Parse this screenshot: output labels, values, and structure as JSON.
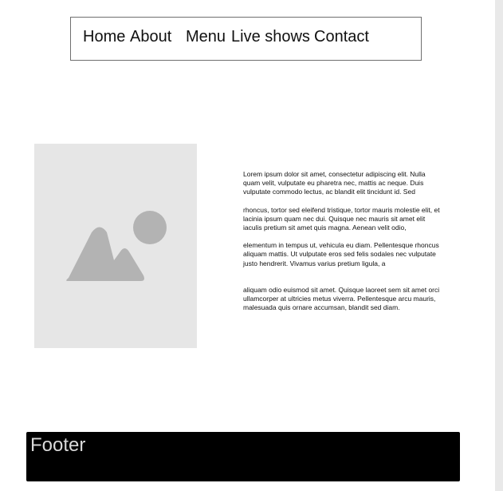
{
  "nav": {
    "items": [
      {
        "label": "Home"
      },
      {
        "label": "About"
      },
      {
        "label": "Menu"
      },
      {
        "label": "Live shows"
      },
      {
        "label": "Contact"
      }
    ]
  },
  "hero_image": {
    "icon": "image-placeholder-icon",
    "colors": {
      "background": "#e6e6e6",
      "shape": "#b3b3b3"
    }
  },
  "article": {
    "paragraphs": [
      "Lorem ipsum dolor sit amet, consectetur adipiscing elit. Nulla quam velit, vulputate eu pharetra nec, mattis ac neque. Duis vulputate commodo lectus, ac blandit elit tincidunt id. Sed",
      "rhoncus, tortor sed eleifend tristique, tortor mauris molestie elit, et lacinia ipsum quam nec dui. Quisque nec mauris sit amet elit iaculis pretium sit amet quis magna. Aenean velit odio,",
      "elementum in tempus ut, vehicula eu diam. Pellentesque rhoncus aliquam mattis. Ut vulputate eros sed felis sodales nec vulputate justo hendrerit. Vivamus varius pretium ligula, a",
      "aliquam odio euismod sit amet. Quisque laoreet sem sit amet orci ullamcorper at ultricies metus viverra. Pellentesque arcu mauris, malesuada quis ornare accumsan, blandit sed diam."
    ]
  },
  "footer": {
    "title": "Footer",
    "colors": {
      "background": "#000000",
      "text": "#d9d9d9"
    }
  }
}
